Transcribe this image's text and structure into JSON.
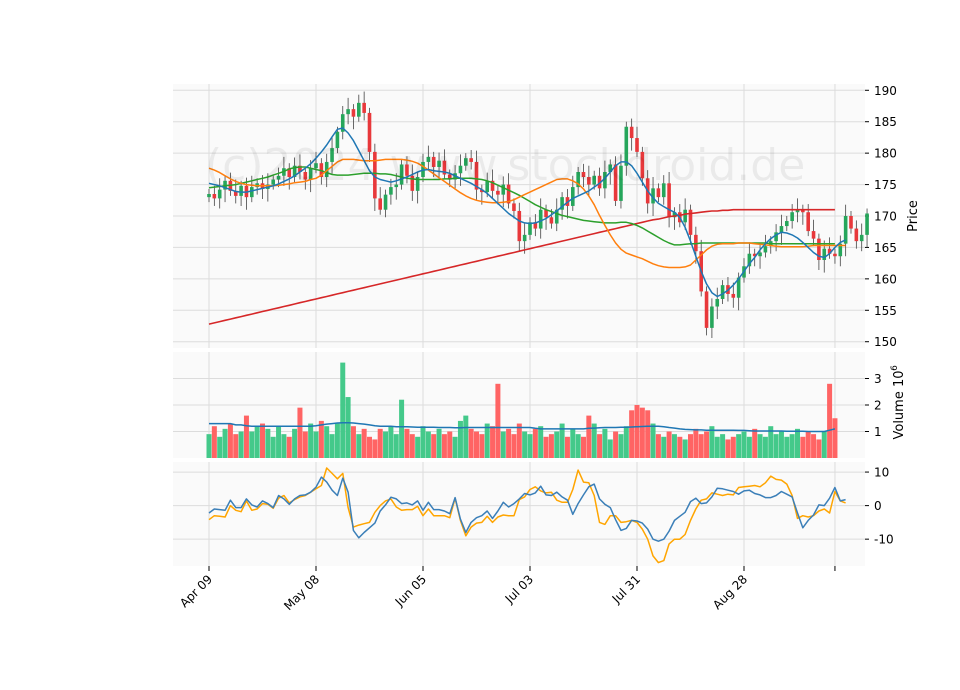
{
  "chart_data": {
    "type": "candlestick",
    "watermark": "(c)2024 www.stockdroid.de",
    "x_tick_labels": [
      "Apr 09",
      "May 08",
      "Jun 05",
      "Jul 03",
      "Jul 31",
      "Aug 28"
    ],
    "n_bars": 118,
    "colors": {
      "up": "#26a65b",
      "down": "#e8383b",
      "ma_short": "#1f77b4",
      "ma_mid": "#ff7f0e",
      "ma_long": "#2ca02c",
      "ma_200": "#d62728",
      "volume_ma": "#1f77b4",
      "osc_a": "#3b7fb8",
      "osc_b": "#ffa500"
    },
    "price_panel": {
      "ylabel": "Price",
      "ylim": [
        149,
        191
      ],
      "ticks": [
        150,
        155,
        160,
        165,
        170,
        175,
        180,
        185,
        190
      ],
      "close": [
        173.5,
        172.8,
        174.2,
        175.6,
        174.0,
        173.2,
        174.8,
        173.0,
        174.6,
        175.2,
        174.3,
        175.0,
        175.8,
        176.4,
        177.6,
        176.2,
        178.0,
        177.0,
        175.8,
        177.6,
        178.4,
        176.2,
        178.6,
        180.8,
        183.4,
        186.2,
        187.0,
        185.8,
        188.0,
        186.4,
        180.2,
        172.8,
        171.0,
        173.4,
        174.6,
        175.0,
        178.2,
        176.4,
        174.0,
        176.2,
        178.6,
        179.4,
        177.8,
        178.8,
        176.6,
        175.8,
        176.8,
        178.0,
        179.2,
        178.6,
        174.2,
        173.8,
        175.6,
        174.0,
        173.4,
        175.0,
        172.0,
        170.8,
        166.0,
        167.0,
        169.0,
        168.0,
        171.0,
        169.8,
        168.8,
        171.0,
        173.0,
        171.6,
        174.6,
        177.0,
        176.2,
        175.0,
        176.4,
        174.4,
        177.0,
        178.2,
        172.4,
        178.0,
        184.2,
        182.4,
        180.2,
        176.0,
        172.0,
        174.4,
        173.0,
        175.2,
        169.8,
        170.6,
        169.0,
        171.0,
        167.0,
        164.4,
        158.0,
        152.2,
        155.6,
        156.8,
        159.0,
        157.6,
        157.0,
        160.2,
        162.0,
        164.0,
        163.6,
        164.2,
        165.2,
        166.0,
        167.4,
        168.4,
        169.2,
        170.6,
        171.0,
        170.6,
        167.6,
        166.4,
        163.0,
        164.8,
        164.0,
        163.6,
        165.6,
        170.0,
        168.0,
        166.0,
        167.0,
        170.4
      ],
      "open": [
        173.0,
        173.5,
        172.8,
        174.2,
        175.6,
        174.0,
        173.2,
        174.8,
        173.0,
        174.6,
        175.2,
        174.3,
        175.0,
        175.8,
        176.4,
        177.6,
        176.2,
        178.0,
        177.0,
        175.8,
        177.6,
        178.4,
        176.2,
        178.6,
        180.8,
        183.4,
        186.2,
        187.0,
        185.8,
        188.0,
        186.4,
        180.2,
        172.8,
        171.0,
        173.4,
        174.6,
        175.0,
        178.2,
        176.4,
        174.0,
        176.2,
        178.6,
        179.4,
        177.8,
        178.8,
        176.6,
        175.8,
        176.8,
        178.0,
        179.2,
        178.6,
        174.2,
        173.8,
        175.6,
        174.0,
        173.4,
        175.0,
        172.0,
        170.8,
        166.0,
        167.0,
        169.0,
        168.0,
        171.0,
        169.8,
        168.8,
        171.0,
        173.0,
        171.6,
        174.6,
        177.0,
        176.2,
        175.0,
        176.4,
        174.4,
        177.0,
        178.2,
        172.4,
        178.0,
        184.2,
        182.4,
        180.2,
        176.0,
        172.0,
        174.4,
        173.0,
        175.2,
        169.8,
        170.6,
        169.0,
        171.0,
        167.0,
        164.4,
        158.0,
        152.2,
        155.6,
        156.8,
        159.0,
        157.6,
        157.0,
        160.2,
        162.0,
        164.0,
        163.6,
        164.2,
        165.2,
        166.0,
        167.4,
        168.4,
        169.2,
        170.6,
        171.0,
        170.6,
        167.6,
        166.4,
        163.0,
        164.8,
        164.0,
        163.6,
        165.6,
        170.0,
        168.0,
        166.0,
        167.0
      ],
      "ma_short": [
        175.2,
        175.0,
        174.8,
        174.5,
        174.2,
        173.9,
        173.8,
        173.8,
        174.0,
        174.2,
        174.4,
        174.6,
        174.8,
        175.1,
        175.5,
        175.9,
        176.4,
        177.0,
        177.6,
        178.3,
        179.2,
        180.2,
        181.3,
        182.6,
        183.8,
        184.0,
        183.2,
        182.0,
        180.4,
        178.8,
        177.2,
        176.2,
        175.8,
        175.6,
        175.4,
        175.6,
        175.9,
        176.2,
        176.6,
        177.0,
        177.3,
        177.4,
        177.2,
        177.1,
        177.0,
        176.8,
        176.4,
        176.0,
        175.6,
        175.2,
        174.7,
        174.2,
        173.6,
        172.8,
        172.0,
        171.2,
        170.4,
        169.8,
        169.2,
        168.9,
        168.8,
        168.9,
        169.2,
        169.6,
        170.2,
        170.8,
        171.5,
        172.2,
        172.8,
        173.2,
        173.6,
        174.0,
        174.6,
        175.2,
        176.0,
        177.0,
        178.0,
        178.6,
        178.6,
        178.0,
        176.8,
        175.4,
        174.0,
        172.9,
        172.0,
        171.5,
        171.0,
        170.6,
        169.8,
        168.2,
        166.0,
        163.6,
        161.2,
        159.2,
        157.8,
        157.2,
        157.6,
        158.2,
        159.0,
        160.0,
        161.2,
        162.4,
        163.4,
        164.6,
        165.6,
        166.4,
        167.0,
        167.4,
        167.3,
        167.0,
        166.5,
        165.8,
        165.0,
        164.2,
        163.6,
        163.4,
        164.0,
        165.0,
        165.8,
        166.2
      ],
      "ma_mid": [
        177.6,
        177.3,
        176.9,
        176.4,
        175.9,
        175.5,
        175.2,
        175.0,
        174.9,
        174.8,
        174.8,
        174.8,
        174.8,
        174.9,
        175.0,
        175.1,
        175.3,
        175.4,
        175.5,
        175.8,
        176.0,
        176.5,
        177.2,
        177.9,
        178.6,
        179.0,
        179.0,
        179.0,
        178.9,
        178.8,
        178.8,
        178.8,
        178.9,
        179.0,
        179.0,
        179.0,
        179.0,
        178.9,
        178.7,
        178.4,
        177.9,
        177.3,
        176.7,
        176.1,
        175.5,
        174.9,
        174.3,
        173.7,
        173.2,
        172.8,
        172.5,
        172.3,
        172.2,
        172.1,
        172.1,
        172.2,
        172.3,
        172.6,
        173.0,
        173.4,
        173.8,
        174.2,
        174.6,
        175.0,
        175.4,
        175.8,
        175.9,
        175.9,
        175.6,
        175.1,
        174.3,
        173.2,
        171.8,
        170.1,
        168.5,
        167.0,
        165.7,
        164.7,
        164.1,
        163.8,
        163.5,
        163.2,
        162.8,
        162.4,
        162.1,
        161.9,
        161.8,
        161.8,
        161.8,
        161.9,
        162.2,
        163.0,
        163.8,
        164.6,
        165.2,
        165.5,
        165.6,
        165.6,
        165.6,
        165.7,
        165.7,
        165.7,
        165.6,
        165.5,
        165.4,
        165.3,
        165.2,
        165.1,
        165.1,
        165.1,
        165.1,
        165.1,
        165.2,
        165.3,
        165.3,
        165.3,
        165.3,
        165.3,
        165.3,
        165.3
      ],
      "ma_long": [
        174.5,
        174.6,
        174.7,
        174.8,
        174.9,
        175.0,
        175.2,
        175.4,
        175.6,
        175.8,
        176.0,
        176.2,
        176.5,
        176.8,
        177.1,
        177.5,
        177.7,
        177.8,
        177.8,
        177.6,
        177.4,
        177.2,
        176.9,
        176.6,
        176.5,
        176.5,
        176.5,
        176.6,
        176.7,
        176.8,
        176.8,
        176.8,
        176.7,
        176.7,
        176.6,
        176.4,
        176.2,
        176.0,
        175.9,
        175.8,
        175.8,
        175.8,
        175.8,
        175.8,
        175.9,
        175.9,
        176.0,
        176.0,
        176.0,
        176.0,
        175.9,
        175.8,
        175.6,
        175.3,
        174.9,
        174.5,
        174.1,
        173.7,
        173.3,
        172.8,
        172.3,
        171.8,
        171.4,
        171.0,
        170.7,
        170.4,
        170.1,
        169.9,
        169.7,
        169.5,
        169.3,
        169.2,
        169.1,
        169.0,
        168.9,
        168.9,
        168.9,
        169.0,
        169.0,
        168.8,
        168.5,
        168.1,
        167.6,
        167.1,
        166.6,
        166.1,
        165.7,
        165.4,
        165.4,
        165.5,
        165.6,
        165.6,
        165.7,
        165.7,
        165.7,
        165.7,
        165.7,
        165.7,
        165.7,
        165.7,
        165.7,
        165.7,
        165.7,
        165.7,
        165.7,
        165.6,
        165.6,
        165.6,
        165.6,
        165.6,
        165.6,
        165.6,
        165.6,
        165.6,
        165.6,
        165.6,
        165.6,
        165.6
      ],
      "ma_200": [
        152.8,
        153.0,
        153.2,
        153.4,
        153.6,
        153.8,
        154.0,
        154.2,
        154.4,
        154.6,
        154.8,
        155.0,
        155.2,
        155.4,
        155.6,
        155.8,
        156.0,
        156.2,
        156.4,
        156.6,
        156.8,
        157.0,
        157.2,
        157.4,
        157.6,
        157.8,
        158.0,
        158.2,
        158.4,
        158.6,
        158.8,
        159.0,
        159.2,
        159.4,
        159.6,
        159.8,
        160.0,
        160.2,
        160.4,
        160.6,
        160.8,
        161.0,
        161.2,
        161.4,
        161.6,
        161.8,
        162.0,
        162.2,
        162.4,
        162.6,
        162.8,
        163.0,
        163.2,
        163.4,
        163.6,
        163.8,
        164.0,
        164.2,
        164.4,
        164.6,
        164.8,
        165.0,
        165.2,
        165.4,
        165.6,
        165.8,
        166.0,
        166.2,
        166.4,
        166.6,
        166.8,
        167.0,
        167.2,
        167.4,
        167.6,
        167.8,
        168.0,
        168.2,
        168.4,
        168.6,
        168.8,
        169.0,
        169.2,
        169.4,
        169.5,
        169.7,
        169.9,
        170.0,
        170.1,
        170.3,
        170.4,
        170.5,
        170.6,
        170.7,
        170.8,
        170.8,
        170.9,
        170.9,
        171.0,
        171.0,
        171.0,
        171.0,
        171.0,
        171.0,
        171.0,
        171.0,
        171.0,
        171.0,
        171.0,
        171.0,
        171.0,
        171.0,
        171.0,
        171.0,
        171.0,
        171.0,
        171.0,
        171.0
      ]
    },
    "volume_panel": {
      "ylabel": "Volume",
      "exponent": "6",
      "ylim": [
        0,
        4.0
      ],
      "ticks": [
        1,
        2,
        3
      ],
      "volume_millions": [
        0.9,
        1.2,
        0.8,
        1.1,
        1.3,
        0.9,
        1.0,
        1.6,
        1.0,
        1.2,
        1.3,
        1.1,
        0.8,
        1.2,
        0.9,
        0.8,
        1.1,
        1.9,
        1.0,
        1.3,
        1.0,
        1.4,
        1.2,
        0.9,
        1.3,
        3.6,
        2.3,
        1.2,
        0.9,
        1.1,
        0.8,
        0.7,
        1.1,
        1.0,
        1.2,
        0.9,
        2.2,
        1.1,
        0.9,
        0.8,
        1.2,
        1.0,
        0.9,
        1.1,
        0.9,
        1.0,
        0.8,
        1.4,
        1.6,
        1.1,
        1.0,
        0.9,
        1.3,
        1.2,
        2.8,
        1.0,
        1.1,
        0.9,
        1.3,
        1.0,
        0.9,
        1.1,
        1.2,
        0.8,
        0.9,
        1.0,
        1.3,
        0.8,
        1.1,
        0.9,
        0.8,
        1.6,
        1.3,
        0.9,
        1.1,
        0.7,
        1.0,
        0.9,
        1.2,
        1.8,
        2.0,
        1.9,
        1.8,
        1.3,
        0.9,
        0.8,
        1.0,
        0.9,
        0.8,
        0.7,
        0.9,
        1.1,
        0.9,
        1.0,
        1.2,
        0.8,
        0.9,
        0.7,
        0.8,
        0.9,
        1.0,
        0.8,
        1.1,
        0.9,
        0.8,
        1.2,
        0.9,
        1.0,
        0.8,
        0.9,
        1.1,
        0.8,
        1.0,
        0.9,
        0.7,
        1.0,
        2.8,
        1.5
      ],
      "volume_ma": [
        1.3,
        1.3,
        1.3,
        1.3,
        1.3,
        1.25,
        1.25,
        1.22,
        1.2,
        1.2,
        1.2,
        1.2,
        1.2,
        1.2,
        1.2,
        1.2,
        1.2,
        1.2,
        1.2,
        1.2,
        1.22,
        1.25,
        1.28,
        1.3,
        1.32,
        1.33,
        1.33,
        1.32,
        1.3,
        1.28,
        1.25,
        1.22,
        1.2,
        1.2,
        1.2,
        1.18,
        1.18,
        1.18,
        1.17,
        1.16,
        1.16,
        1.16,
        1.16,
        1.15,
        1.15,
        1.15,
        1.14,
        1.14,
        1.15,
        1.15,
        1.15,
        1.15,
        1.15,
        1.15,
        1.15,
        1.15,
        1.15,
        1.15,
        1.15,
        1.15,
        1.15,
        1.12,
        1.1,
        1.1,
        1.1,
        1.1,
        1.1,
        1.1,
        1.1,
        1.1,
        1.1,
        1.12,
        1.13,
        1.14,
        1.15,
        1.15,
        1.15,
        1.16,
        1.16,
        1.17,
        1.18,
        1.19,
        1.2,
        1.2,
        1.2,
        1.18,
        1.15,
        1.13,
        1.1,
        1.08,
        1.07,
        1.06,
        1.06,
        1.05,
        1.05,
        1.05,
        1.05,
        1.05,
        1.05,
        1.04,
        1.04,
        1.03,
        1.02,
        1.02,
        1.02,
        1.02,
        1.02,
        1.02,
        1.01,
        1.01,
        1.01,
        1.01,
        1.0,
        1.0,
        1.0,
        1.0,
        1.05,
        1.1
      ]
    },
    "oscillator_panel": {
      "ylim": [
        -18,
        13
      ],
      "ticks": [
        -10,
        0,
        10
      ],
      "line_a": [
        -2.2,
        -1.0,
        -1.2,
        -1.4,
        1.6,
        -0.6,
        -0.6,
        2.0,
        0.2,
        -0.4,
        1.4,
        0.6,
        -0.6,
        3.0,
        2.0,
        0.4,
        2.0,
        3.0,
        3.2,
        4.0,
        5.5,
        8.5,
        7.0,
        4.6,
        3.0,
        8.2,
        4.0,
        -7.4,
        -9.6,
        -8.0,
        -6.6,
        -5.2,
        -1.6,
        0.2,
        2.5,
        2.0,
        0.6,
        0.8,
        0.2,
        1.4,
        -1.4,
        1.0,
        -1.2,
        -1.2,
        -1.6,
        -2.4,
        2.4,
        -4.0,
        -8.0,
        -5.0,
        -3.6,
        -3.0,
        -1.6,
        -3.8,
        -1.6,
        1.0,
        -0.4,
        0.6,
        2.0,
        3.6,
        3.2,
        3.8,
        5.8,
        3.2,
        3.0,
        4.0,
        2.6,
        1.6,
        -2.6,
        0.6,
        3.2,
        5.6,
        6.4,
        2.0,
        0.4,
        -0.6,
        -4.2,
        -7.4,
        -6.8,
        -4.4,
        -4.6,
        -5.2,
        -7.0,
        -10.0,
        -10.6,
        -10.0,
        -7.6,
        -4.4,
        -3.2,
        -2.0,
        1.2,
        2.2,
        0.6,
        0.8,
        2.6,
        5.2,
        5.0,
        4.6,
        4.2,
        3.4,
        4.4,
        4.6,
        3.6,
        3.2,
        2.4,
        2.4,
        3.0,
        4.2,
        3.4,
        2.6,
        -2.2,
        -6.6,
        -4.4,
        -2.8,
        0.2,
        0.0,
        2.2,
        5.4,
        1.4,
        1.8
      ],
      "line_b": [
        -4.2,
        -3.0,
        -3.2,
        -3.4,
        0.0,
        -1.4,
        -1.8,
        1.4,
        -1.4,
        -1.0,
        0.6,
        0.4,
        -0.8,
        2.2,
        3.0,
        0.8,
        1.8,
        2.6,
        3.0,
        4.0,
        5.0,
        6.0,
        11.2,
        9.6,
        8.0,
        9.6,
        -0.6,
        -6.4,
        -5.8,
        -5.4,
        -5.0,
        -2.0,
        0.0,
        1.4,
        2.0,
        -0.4,
        -1.4,
        -1.2,
        -1.2,
        -0.2,
        -3.0,
        -1.0,
        -3.0,
        -3.0,
        -3.0,
        -3.6,
        2.2,
        -4.4,
        -9.0,
        -6.4,
        -5.2,
        -5.0,
        -3.2,
        -5.0,
        -3.4,
        -2.8,
        -3.0,
        -3.0,
        1.8,
        2.6,
        4.8,
        5.6,
        4.4,
        3.8,
        4.0,
        1.6,
        1.0,
        1.0,
        4.8,
        10.6,
        7.0,
        6.8,
        3.0,
        -5.0,
        -5.6,
        -3.0,
        -3.0,
        -5.0,
        -4.8,
        -4.4,
        -5.0,
        -7.0,
        -10.0,
        -15.0,
        -17.0,
        -16.4,
        -11.4,
        -10.0,
        -10.0,
        -8.6,
        -4.4,
        -1.0,
        1.6,
        2.0,
        3.8,
        3.4,
        3.0,
        3.4,
        3.2,
        5.4,
        5.6,
        5.8,
        6.0,
        5.6,
        6.8,
        8.8,
        7.8,
        7.6,
        6.4,
        3.0,
        -3.8,
        -3.0,
        -3.4,
        -3.0,
        -1.6,
        -1.0,
        -2.2,
        4.2,
        1.4,
        0.8
      ]
    }
  }
}
